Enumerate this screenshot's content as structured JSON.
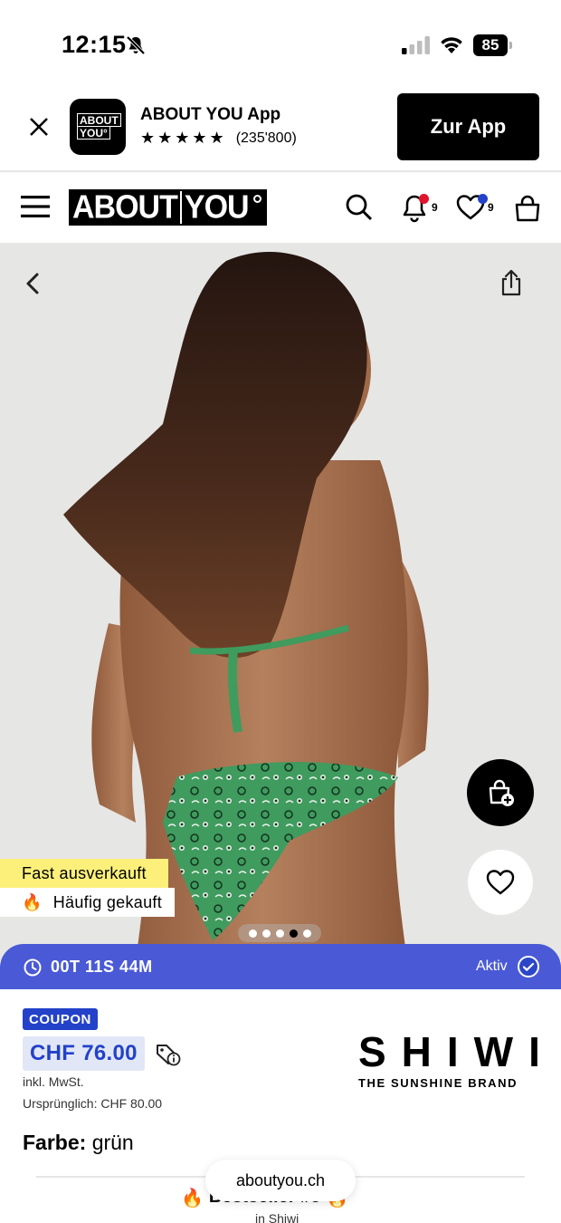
{
  "status_bar": {
    "time": "12:15",
    "battery": "85"
  },
  "app_banner": {
    "app_name": "ABOUT YOU App",
    "icon_text_1": "ABOUT",
    "icon_text_2": "YOU°",
    "stars": "★★★★★",
    "rating_count": "(235'800)",
    "cta_label": "Zur App"
  },
  "header": {
    "logo_left": "ABOUT",
    "logo_right": "YOU",
    "notifications_count": "9",
    "wishlist_count": "9",
    "notification_dot_color": "#e0142c",
    "wishlist_dot_color": "#2342c9"
  },
  "product_image": {
    "carousel_total": 5,
    "carousel_active": 4,
    "stock_label": "Fast ausverkauft",
    "popular_label": "Häufig gekauft",
    "popular_icon": "🔥"
  },
  "countdown": {
    "time": "00T 11S 44M",
    "status": "Aktiv",
    "color": "#4a5ad6"
  },
  "price": {
    "coupon_label": "COUPON",
    "current": "CHF 76.00",
    "vat": "inkl. MwSt.",
    "original_label": "Ursprünglich:",
    "original_value": "CHF 80.00",
    "accent_color": "#2342c9"
  },
  "brand": {
    "name": "SHIWI",
    "tagline": "THE SUNSHINE BRAND"
  },
  "color": {
    "label": "Farbe:",
    "value": "grün"
  },
  "bestseller": {
    "icon": "🔥",
    "title": "Bestseller #3",
    "subtitle": "in Shiwi"
  },
  "browser": {
    "url": "aboutyou.ch"
  }
}
